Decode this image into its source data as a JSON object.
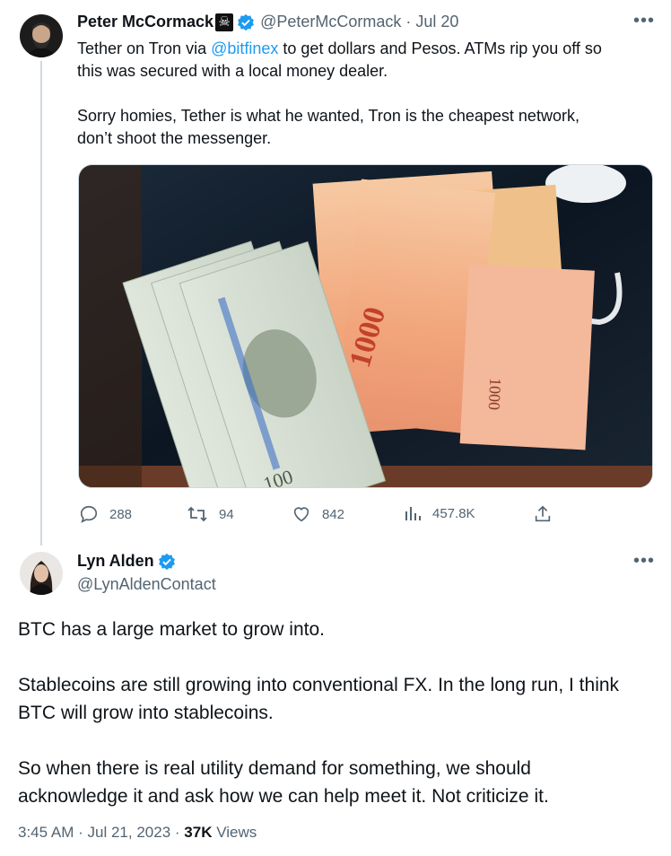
{
  "tweet1": {
    "author_name": "Peter McCormack",
    "author_emoji": "☠",
    "handle": "@PeterMcCormack",
    "separator": "·",
    "date": "Jul 20",
    "more_icon": "more-horizontal-icon",
    "text_line1_pre": "Tether on Tron via ",
    "text_mention": "@bitfinex",
    "text_line1_post": " to get dollars and Pesos. ATMs rip you off so",
    "text_line2": "this was secured with a local money dealer.",
    "text_line3": "Sorry homies, Tether is what he wanted, Tron is the cheapest network,",
    "text_line4": "don’t shoot the messenger.",
    "photo": {
      "labels": [
        "100",
        "1000",
        "1000",
        "1000",
        "100"
      ]
    },
    "metrics": {
      "replies": "288",
      "reposts": "94",
      "likes": "842",
      "views": "457.8K"
    },
    "colors": {
      "verified": "#1d9bf0",
      "link": "#1d9bf0",
      "muted": "#536471"
    }
  },
  "tweet2": {
    "author_name": "Lyn Alden",
    "handle": "@LynAldenContact",
    "more_icon": "more-horizontal-icon",
    "para1": "BTC has a large market to grow into.",
    "para2_line1": "Stablecoins are still growing into conventional FX. In the long run, I think",
    "para2_line2": "BTC will grow into stablecoins.",
    "para3_line1": "So when there is real utility demand for something, we should",
    "para3_line2": "acknowledge it and ask how we can help meet it. Not criticize it.",
    "time": "3:45 AM",
    "sep1": "·",
    "date": "Jul 21, 2023",
    "sep2": "·",
    "views_count": "37K",
    "views_label": "Views"
  }
}
